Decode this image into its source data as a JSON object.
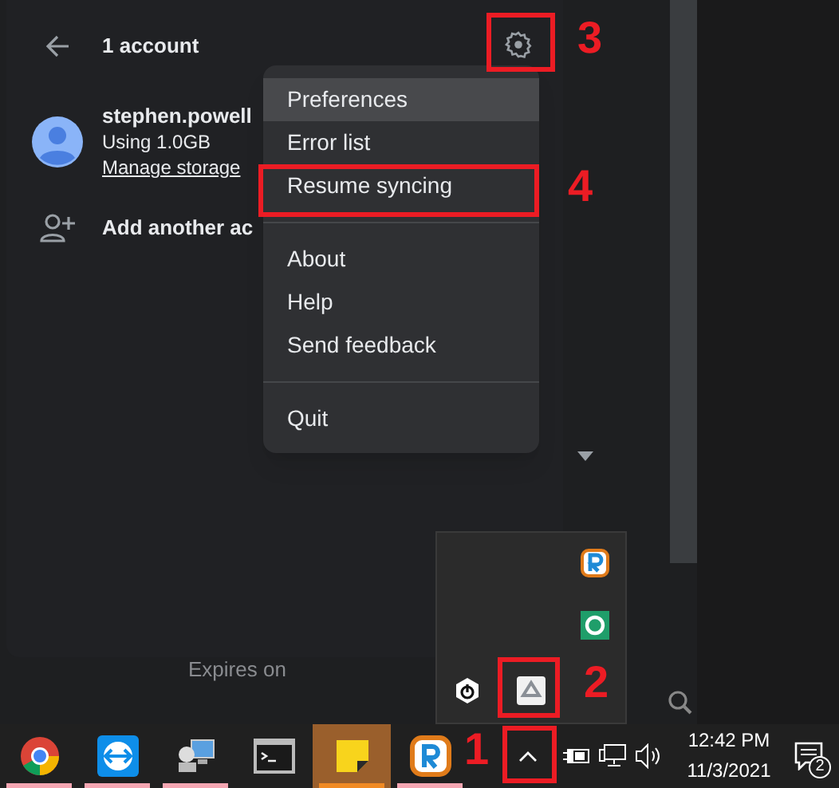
{
  "account_panel": {
    "title": "1 account",
    "account": {
      "name": "stephen.powell",
      "usage": "Using 1.0GB",
      "link": "Manage storage"
    },
    "add_account": "Add another ac"
  },
  "menu": {
    "sections": [
      [
        {
          "label": "Preferences",
          "hovered": true
        },
        {
          "label": "Error list",
          "hovered": false
        },
        {
          "label": "Resume syncing",
          "hovered": false
        }
      ],
      [
        {
          "label": "About",
          "hovered": false
        },
        {
          "label": "Help",
          "hovered": false
        },
        {
          "label": "Send feedback",
          "hovered": false
        }
      ],
      [
        {
          "label": "Quit",
          "hovered": false
        }
      ]
    ]
  },
  "background": {
    "text": "Expires on"
  },
  "tray_overflow": {
    "icons": [
      {
        "kind": "r-app"
      },
      {
        "kind": "circle-app"
      },
      {
        "kind": "power"
      },
      {
        "kind": "drive"
      }
    ]
  },
  "taskbar": {
    "apps": [
      {
        "kind": "chrome",
        "running": true,
        "active": false
      },
      {
        "kind": "remote",
        "running": true,
        "active": false
      },
      {
        "kind": "network",
        "running": true,
        "active": false
      },
      {
        "kind": "terminal",
        "running": false,
        "active": false
      },
      {
        "kind": "notes",
        "running": true,
        "active": true
      },
      {
        "kind": "r-app",
        "running": true,
        "active": false
      }
    ],
    "time": "12:42 PM",
    "date": "11/3/2021",
    "notifications": "2"
  },
  "annotations": [
    {
      "number": "3"
    },
    {
      "number": "4"
    },
    {
      "number": "2"
    },
    {
      "number": "1"
    }
  ]
}
